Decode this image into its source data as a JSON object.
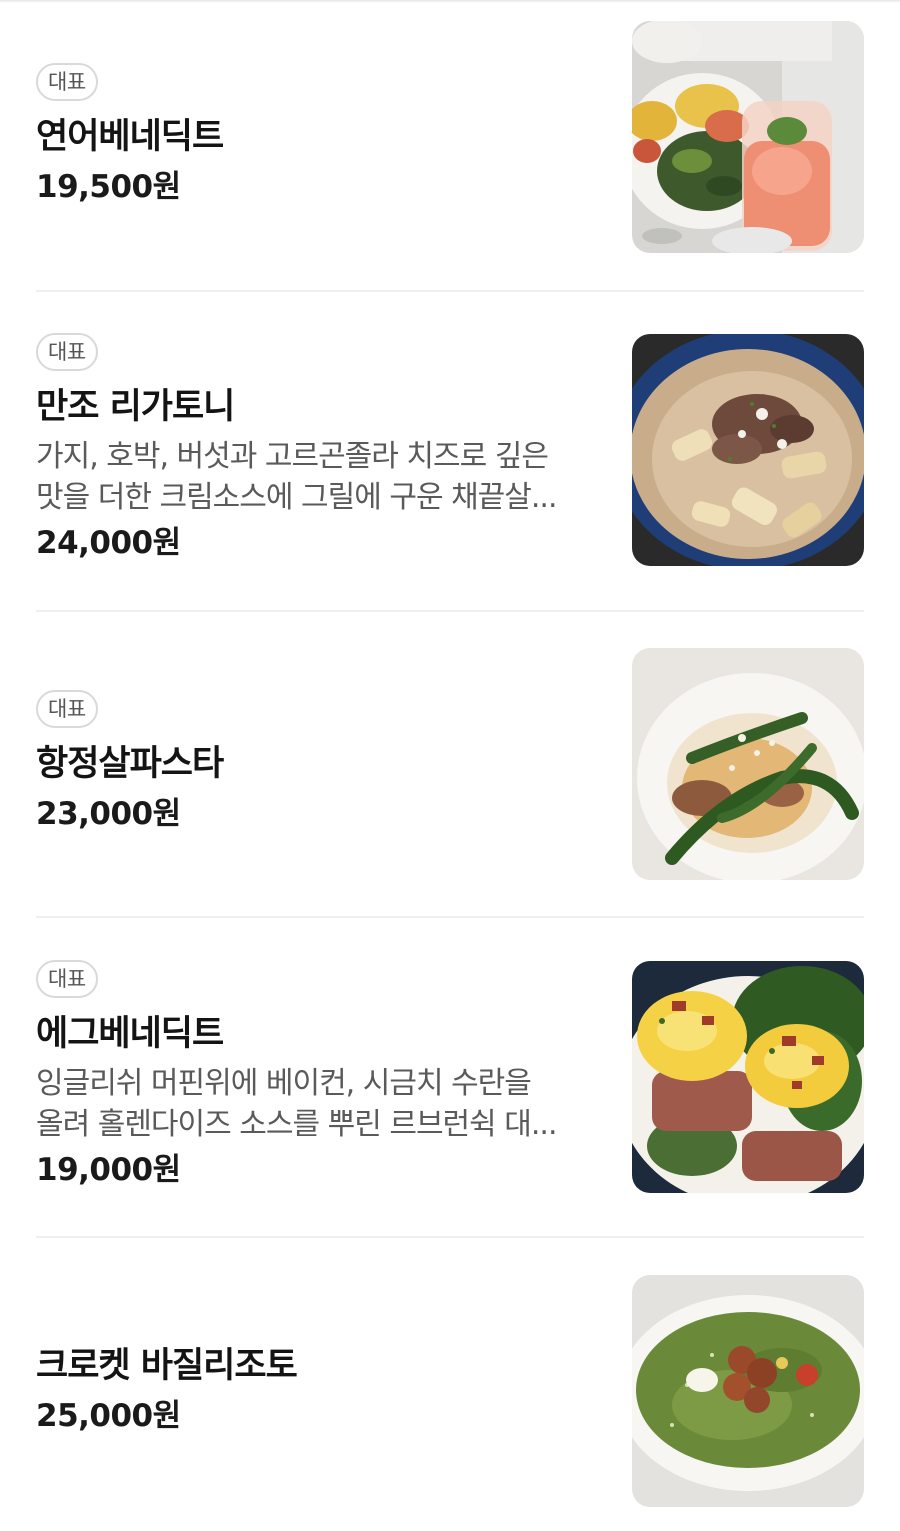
{
  "menu": {
    "items": [
      {
        "badge": "대표",
        "name": "연어베네딕트",
        "desc_line1": "",
        "desc_line2": "",
        "price": "19,500원",
        "image_icon": "salmon-benedict-photo"
      },
      {
        "badge": "대표",
        "name": "만조 리가토니",
        "desc_line1": "가지, 호박, 버섯과 고르곤졸라 치즈로 깊은",
        "desc_line2": "맛을 더한 크림소스에 그릴에 구운 채끝살...",
        "price": "24,000원",
        "image_icon": "rigatoni-photo"
      },
      {
        "badge": "대표",
        "name": "항정살파스타",
        "desc_line1": "",
        "desc_line2": "",
        "price": "23,000원",
        "image_icon": "pork-neck-pasta-photo"
      },
      {
        "badge": "대표",
        "name": "에그베네딕트",
        "desc_line1": "잉글리쉬 머핀위에 베이컨, 시금치 수란을",
        "desc_line2": "올려 홀렌다이즈 소스를 뿌린 르브런쉭 대...",
        "price": "19,000원",
        "image_icon": "egg-benedict-photo"
      },
      {
        "badge": "",
        "name": "크로켓 바질리조토",
        "desc_line1": "",
        "desc_line2": "",
        "price": "25,000원",
        "image_icon": "basil-risotto-photo"
      }
    ]
  },
  "colors": {
    "text_primary": "#141414",
    "text_secondary": "#5a5a5a",
    "badge_border": "#d9d9d9",
    "divider": "#efefef"
  }
}
